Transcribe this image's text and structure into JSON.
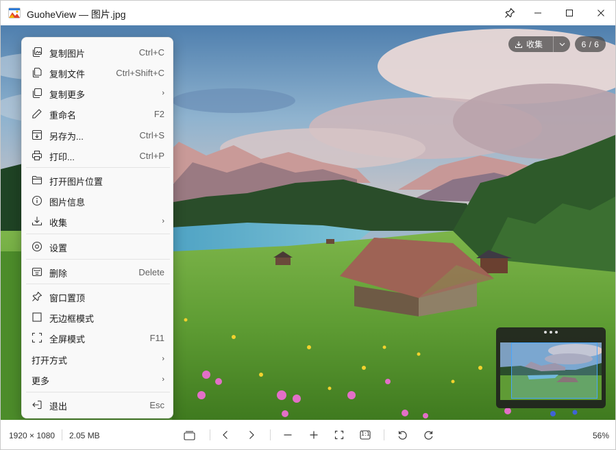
{
  "window": {
    "title": "GuoheView — 图片.jpg",
    "app_icon": "guoheview-logo-icon",
    "controls": {
      "pin": "pin-icon",
      "minimize": "minimize-icon",
      "maximize": "maximize-icon",
      "close": "close-icon"
    }
  },
  "overlay": {
    "collect_label": "收集",
    "counter": "6 / 6"
  },
  "menu": {
    "items": [
      {
        "icon": "copy-image-icon",
        "label": "复制图片",
        "shortcut": "Ctrl+C"
      },
      {
        "icon": "copy-file-icon",
        "label": "复制文件",
        "shortcut": "Ctrl+Shift+C"
      },
      {
        "icon": "copy-more-icon",
        "label": "复制更多",
        "arrow": "›"
      },
      {
        "icon": "rename-icon",
        "label": "重命名",
        "shortcut": "F2"
      },
      {
        "icon": "save-as-icon",
        "label": "另存为...",
        "shortcut": "Ctrl+S"
      },
      {
        "icon": "print-icon",
        "label": "打印...",
        "shortcut": "Ctrl+P"
      },
      {
        "icon": "folder-icon",
        "label": "打开图片位置"
      },
      {
        "icon": "info-icon",
        "label": "图片信息"
      },
      {
        "icon": "collect-icon",
        "label": "收集",
        "arrow": "›"
      },
      {
        "icon": "settings-icon",
        "label": "设置"
      },
      {
        "icon": "delete-icon",
        "label": "删除",
        "shortcut": "Delete"
      },
      {
        "icon": "pin-icon",
        "label": "窗口置顶"
      },
      {
        "icon": "checkbox-icon",
        "label": "无边框模式"
      },
      {
        "icon": "fullscreen-icon",
        "label": "全屏模式",
        "shortcut": "F11"
      },
      {
        "label": "打开方式",
        "arrow": "›"
      },
      {
        "label": "更多",
        "arrow": "›"
      },
      {
        "icon": "exit-icon",
        "label": "退出",
        "shortcut": "Esc"
      }
    ]
  },
  "status": {
    "dimensions": "1920 × 1080",
    "file_size": "2.05 MB",
    "zoom": "56%",
    "tools": [
      "gallery-icon",
      "previous-icon",
      "next-icon",
      "zoom-out-icon",
      "zoom-in-icon",
      "fit-window-icon",
      "actual-size-icon",
      "rotate-left-icon",
      "rotate-right-icon"
    ],
    "actual_size_label": "1:1"
  },
  "colors": {
    "accent": "#47a6ff",
    "menu_background": "#f9f9f9",
    "pill_background": "#464646"
  }
}
